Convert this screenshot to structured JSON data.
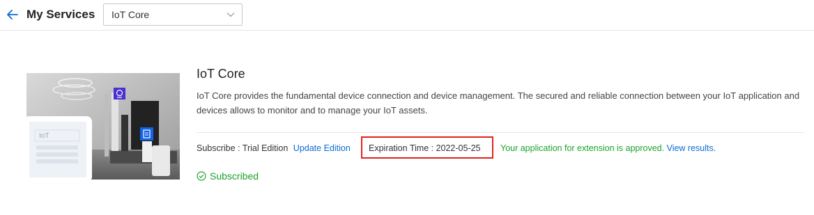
{
  "header": {
    "title": "My Services",
    "service_select": {
      "value": "IoT Core"
    }
  },
  "service": {
    "title": "IoT Core",
    "description": "IoT Core provides the fundamental device connection and device management. The secured and reliable connection between your IoT application and devices allows to monitor and to manage your IoT assets.",
    "subscribe_label": "Subscribe : Trial Edition",
    "update_link": "Update Edition",
    "expiration": "Expiration Time : 2022-05-25",
    "approval_message": "Your application for extension is approved.",
    "view_results_link": "View results.",
    "status": "Subscribed",
    "thumbnail_screen_label": "IoT"
  },
  "colors": {
    "accent": "#0b6bd3",
    "success": "#1aa32a",
    "highlight_border": "#e0231c",
    "icon_badge": "#4b2fd1",
    "icon_badge_blue": "#1463e8"
  },
  "icons": {
    "back": "arrow-left-icon",
    "dropdown": "chevron-down-icon",
    "status": "check-circle-icon"
  }
}
